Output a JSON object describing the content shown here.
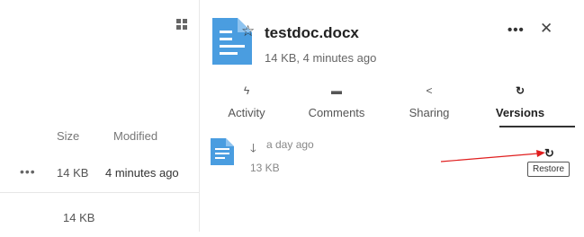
{
  "file_list": {
    "headers": {
      "size": "Size",
      "modified": "Modified"
    },
    "rows": [
      {
        "menu": "•••",
        "size": "14 KB",
        "modified": "4 minutes ago"
      },
      {
        "menu": "",
        "size": "14 KB",
        "modified": ""
      }
    ]
  },
  "sidebar": {
    "title": "testdoc.docx",
    "meta": "14 KB, 4 minutes ago",
    "more_label": "•••",
    "close_label": "✕",
    "star_label": "☆",
    "tabs": [
      {
        "label": "Activity",
        "icon": "lightning-icon",
        "glyph": "ϟ"
      },
      {
        "label": "Comments",
        "icon": "comment-icon",
        "glyph": "▬"
      },
      {
        "label": "Sharing",
        "icon": "share-icon",
        "glyph": "<"
      },
      {
        "label": "Versions",
        "icon": "restore-icon",
        "glyph": "↻",
        "active": true
      }
    ],
    "versions": [
      {
        "time": "a day ago",
        "size": "13 KB",
        "download_glyph": "🡓",
        "restore_glyph": "↻",
        "restore_tooltip": "Restore"
      }
    ]
  },
  "colors": {
    "file_icon": "#4a9de0",
    "annotation_arrow": "#e01e1e"
  }
}
